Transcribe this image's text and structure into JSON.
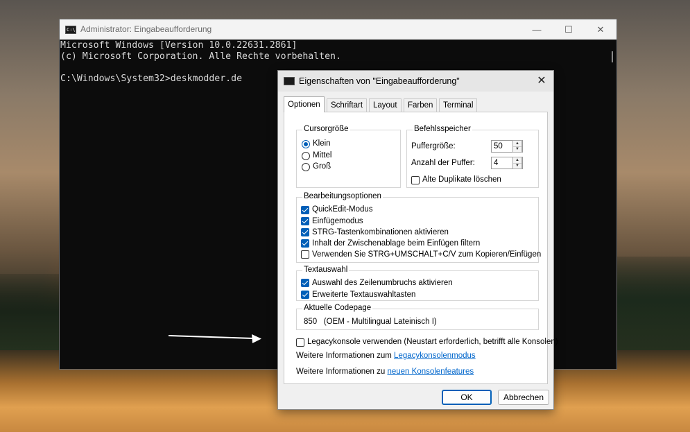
{
  "console": {
    "title": "Administrator: Eingabeaufforderung",
    "icon": "C:\\",
    "controls": {
      "minimize": "—",
      "maximize": "☐",
      "close": "✕"
    },
    "lines": [
      "Microsoft Windows [Version 10.0.22631.2861]",
      "(c) Microsoft Corporation. Alle Rechte vorbehalten.",
      "",
      "C:\\Windows\\System32>deskmodder.de"
    ]
  },
  "dialog": {
    "title": "Eigenschaften von \"Eingabeaufforderung\"",
    "close": "✕",
    "tabs": [
      "Optionen",
      "Schriftart",
      "Layout",
      "Farben",
      "Terminal"
    ],
    "active_tab": "Optionen",
    "cursor_group": {
      "label": "Cursorgröße",
      "options": [
        {
          "label": "Klein",
          "checked": true
        },
        {
          "label": "Mittel",
          "checked": false
        },
        {
          "label": "Groß",
          "checked": false
        }
      ]
    },
    "history_group": {
      "label": "Befehlsspeicher",
      "buffer_size_label": "Puffergröße:",
      "buffer_size_value": "50",
      "buffer_count_label": "Anzahl der Puffer:",
      "buffer_count_value": "4",
      "discard_duplicates_label": "Alte Duplikate löschen",
      "discard_duplicates_checked": false
    },
    "edit_group": {
      "label": "Bearbeitungsoptionen",
      "options": [
        {
          "label": "QuickEdit-Modus",
          "checked": true
        },
        {
          "label": "Einfügemodus",
          "checked": true
        },
        {
          "label": "STRG-Tastenkombinationen aktivieren",
          "checked": true
        },
        {
          "label": "Inhalt der Zwischenablage beim Einfügen filtern",
          "checked": true
        },
        {
          "label": "Verwenden Sie STRG+UMSCHALT+C/V zum Kopieren/Einfügen",
          "checked": false
        }
      ]
    },
    "selection_group": {
      "label": "Textauswahl",
      "options": [
        {
          "label": "Auswahl des Zeilenumbruchs aktivieren",
          "checked": true
        },
        {
          "label": "Erweiterte Textauswahltasten",
          "checked": true
        }
      ]
    },
    "codepage_group": {
      "label": "Aktuelle Codepage",
      "value": "850   (OEM - Multilingual Lateinisch I)"
    },
    "legacy": {
      "label": "Legacykonsole verwenden (Neustart erforderlich, betrifft alle Konsolen)",
      "checked": false,
      "info1_prefix": "Weitere Informationen zum ",
      "info1_link": "Legacykonsolenmodus",
      "info2_prefix": "Weitere Informationen zu ",
      "info2_link": "neuen Konsolenfeatures"
    },
    "buttons": {
      "ok": "OK",
      "cancel": "Abbrechen"
    }
  },
  "colors": {
    "accent": "#005fb8",
    "link": "#0066cc",
    "console_bg": "#0c0c0c"
  }
}
